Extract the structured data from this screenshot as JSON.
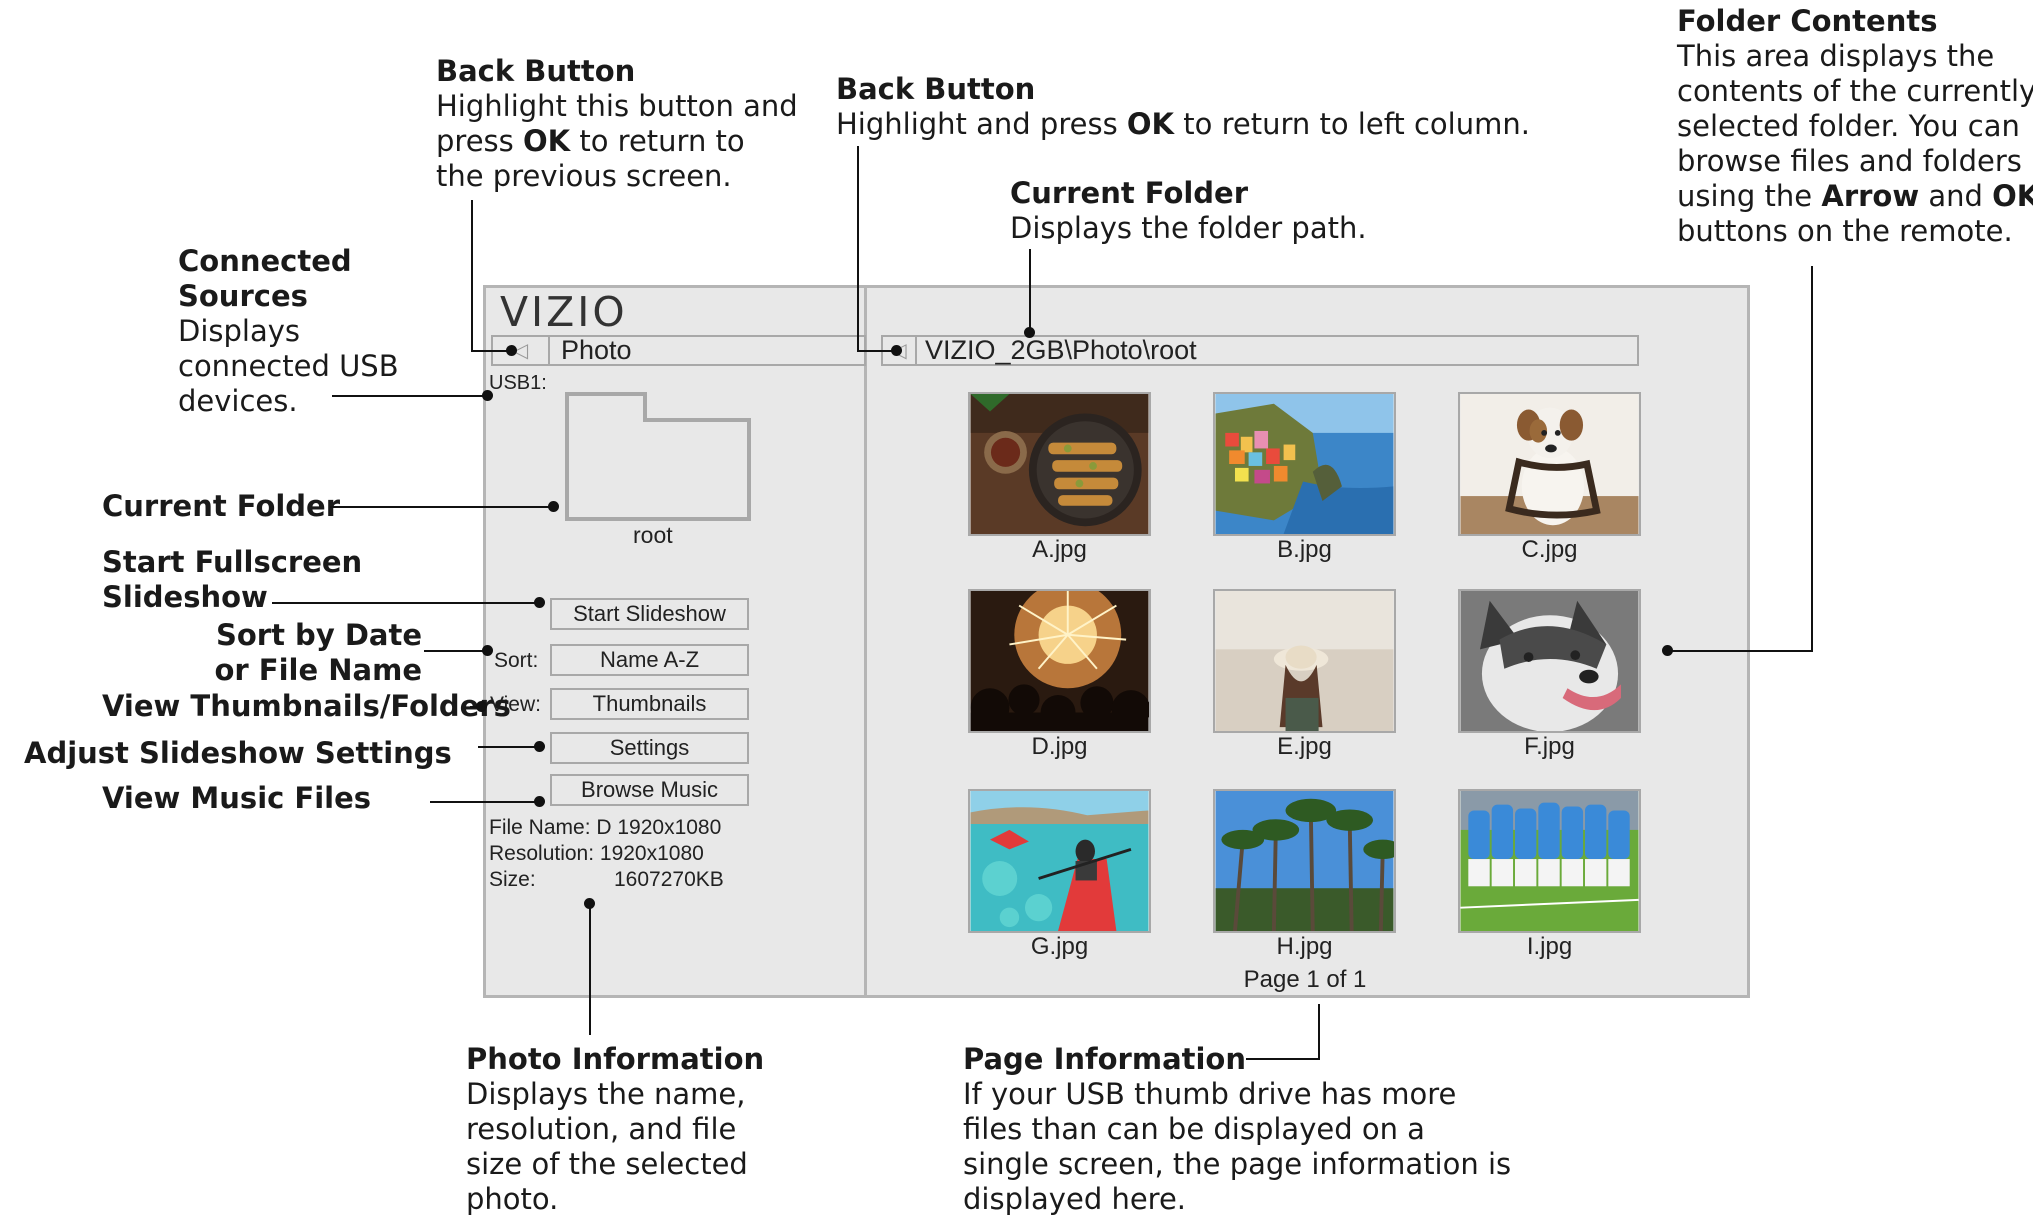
{
  "annotations": {
    "back_button_left": {
      "title": "Back Button",
      "lines": [
        "Highlight this button and",
        "press ",
        "OK",
        " to return to",
        "the previous screen."
      ]
    },
    "back_button_right": {
      "title": "Back Button",
      "pre": "Highlight and press ",
      "bold": "OK",
      "post": " to return to left column."
    },
    "current_folder_top": {
      "title": "Current Folder",
      "desc": "Displays the folder path."
    },
    "folder_contents": {
      "title": "Folder Contents",
      "l1": "This area displays the",
      "l2": "contents of the currently",
      "l3": "selected folder. You can",
      "l4": "browse files and folders",
      "l5a": "using the ",
      "l5b": "Arrow",
      "l5c": " and ",
      "l5d": "OK",
      "l6": "buttons on the remote."
    },
    "connected_sources": {
      "t1": "Connected",
      "t2": "Sources",
      "l1": "Displays",
      "l2": "connected USB",
      "l3": "devices."
    },
    "current_folder_left": "Current Folder",
    "start_fullscreen": {
      "t1": "Start Fullscreen",
      "t2": "Slideshow"
    },
    "sort_by": {
      "t1": "Sort by Date",
      "t2": "or File Name"
    },
    "view_thumbs": "View Thumbnails/Folders",
    "adjust_settings": "Adjust Slideshow Settings",
    "view_music": "View Music Files",
    "photo_info": {
      "title": "Photo Information",
      "l1": "Displays the name,",
      "l2": "resolution, and file",
      "l3": "size of the selected",
      "l4": "photo."
    },
    "page_info": {
      "title": "Page Information",
      "l1": "If your USB thumb drive has more",
      "l2": "files than can be displayed on a",
      "l3": "single screen, the page information is",
      "l4": "displayed here."
    }
  },
  "screen": {
    "logo": "VIZIO",
    "left_nav": {
      "back_glyph": "◁",
      "label": "Photo"
    },
    "path_nav": {
      "back_glyph": "◁",
      "path": "VIZIO_2GB\\Photo\\root"
    },
    "usb_label": "USB1:",
    "folder_name": "root",
    "buttons": {
      "start_slideshow": "Start Slideshow",
      "sort_label": "Sort:",
      "sort_value": "Name A-Z",
      "view_label": "View:",
      "view_value": "Thumbnails",
      "settings": "Settings",
      "browse_music": "Browse Music"
    },
    "info": {
      "file_name": "File Name: D 1920x1080",
      "resolution": "Resolution: 1920x1080",
      "size_label": "Size:",
      "size_value": "1607270KB"
    },
    "thumbnails": [
      {
        "name": "A.jpg",
        "subject": "food skewers"
      },
      {
        "name": "B.jpg",
        "subject": "coastal village"
      },
      {
        "name": "C.jpg",
        "subject": "dog with leash"
      },
      {
        "name": "D.jpg",
        "subject": "fireworks crowd"
      },
      {
        "name": "E.jpg",
        "subject": "woman with hat"
      },
      {
        "name": "F.jpg",
        "subject": "husky dog"
      },
      {
        "name": "G.jpg",
        "subject": "kayaking"
      },
      {
        "name": "H.jpg",
        "subject": "palm trees"
      },
      {
        "name": "I.jpg",
        "subject": "soccer team"
      }
    ],
    "page_info": "Page 1 of 1"
  },
  "colors": {
    "screen_bg": "#e8e8e8",
    "border": "#b5b5b5",
    "leader": "#111111"
  }
}
